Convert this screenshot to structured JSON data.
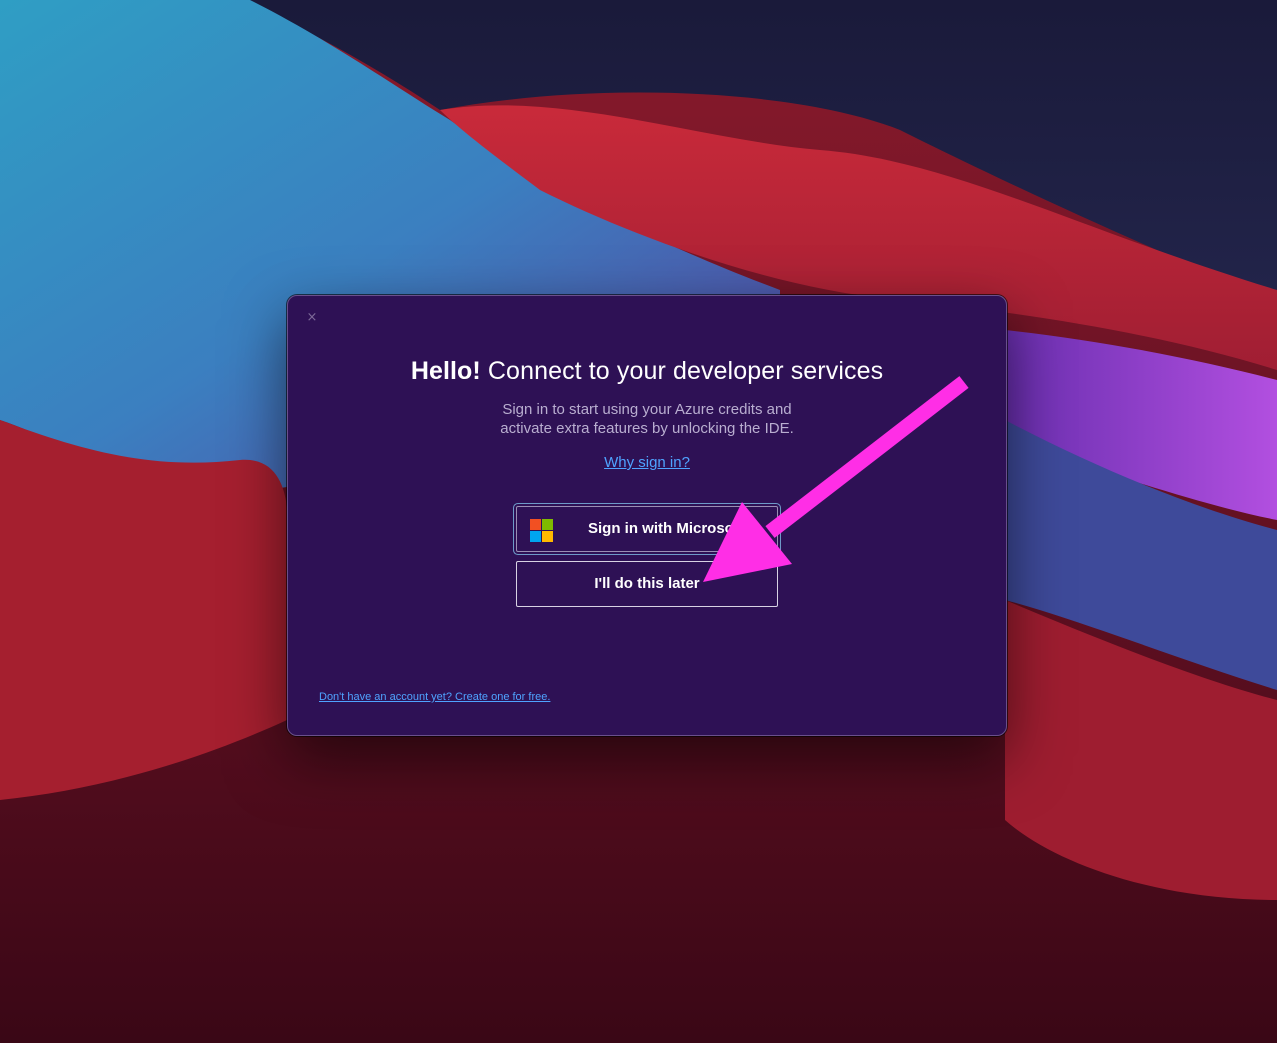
{
  "dialog": {
    "close_glyph": "×",
    "title_bold": "Hello!",
    "title_rest": " Connect to your developer services",
    "subtitle_line1": "Sign in to start using your Azure credits and",
    "subtitle_line2": "activate extra features by unlocking the IDE.",
    "why_link": "Why sign in?",
    "sign_in_button": "Sign in with Microsoft",
    "later_button": "I'll do this later",
    "create_account_link": "Don't have an account yet? Create one for free."
  },
  "icons": {
    "close": "close-icon",
    "microsoft": "microsoft-logo-icon",
    "annotation": "annotation-arrow-icon"
  },
  "colors": {
    "dialog_bg": "#2e1155",
    "link": "#4fa3ff",
    "annotation_arrow": "#ff2ee6",
    "ms_red": "#f25022",
    "ms_green": "#7fba00",
    "ms_blue": "#00a4ef",
    "ms_yellow": "#ffb900"
  }
}
